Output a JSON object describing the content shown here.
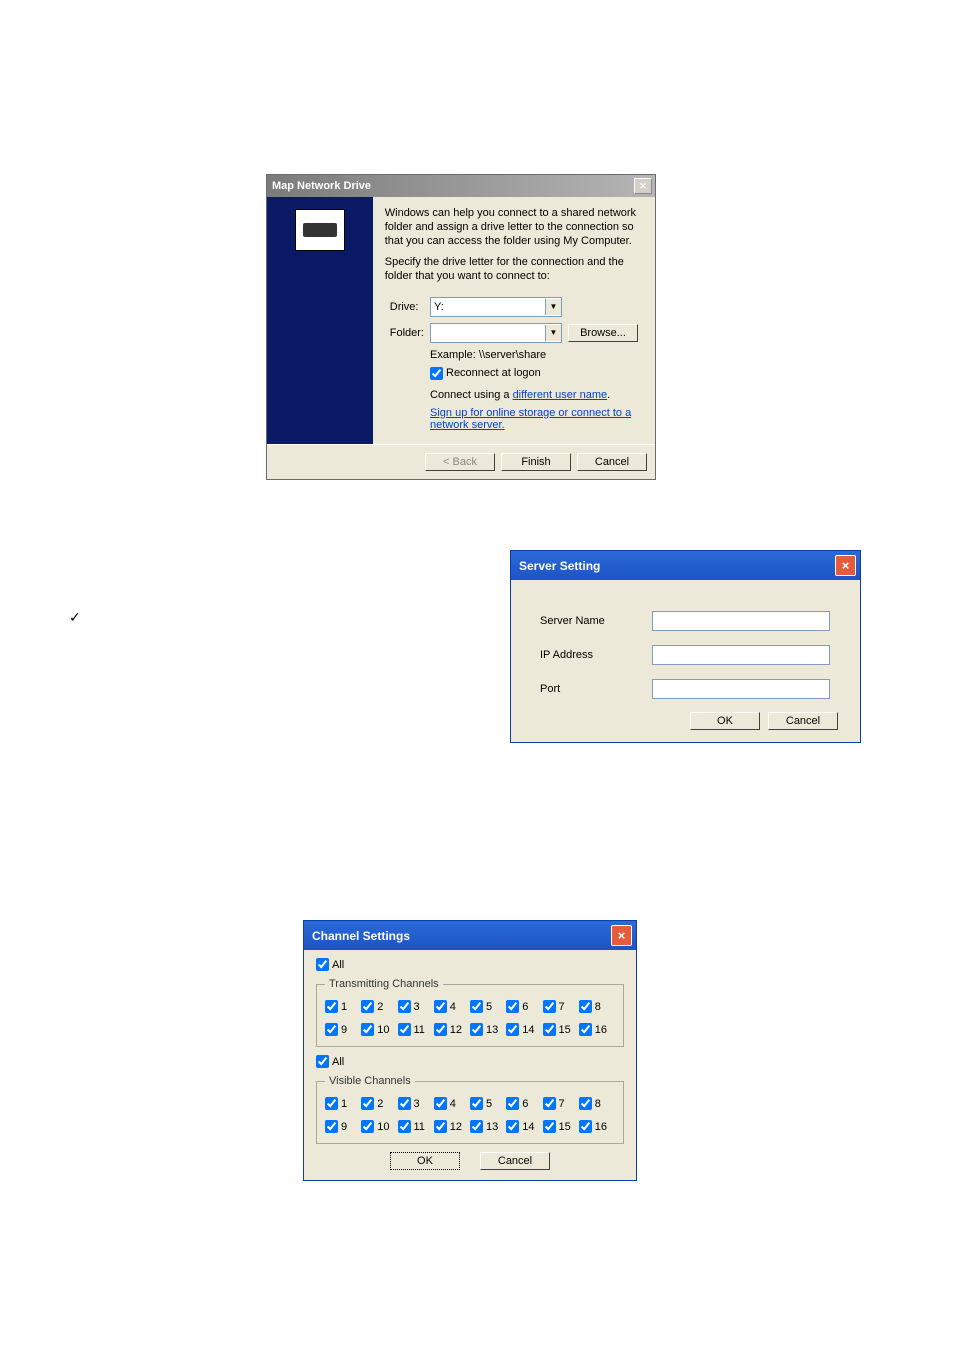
{
  "map_dialog": {
    "title": "Map Network Drive",
    "para1": "Windows can help you connect to a shared network folder and assign a drive letter to the connection so that you can access the folder using My Computer.",
    "para2": "Specify the drive letter for the connection and the folder that you want to connect to:",
    "drive_label": "Drive:",
    "drive_value": "Y:",
    "folder_label": "Folder:",
    "folder_value": "",
    "browse": "Browse...",
    "example": "Example: \\\\server\\share",
    "reconnect": "Reconnect at logon",
    "connect_prefix": "Connect using a ",
    "connect_link": "different user name",
    "connect_suffix": ".",
    "signup_link": "Sign up for online storage or connect to a network server.",
    "back": "< Back",
    "finish": "Finish",
    "cancel": "Cancel"
  },
  "server_dialog": {
    "title": "Server Setting",
    "name_label": "Server Name",
    "ip_label": "IP Address",
    "port_label": "Port",
    "ok": "OK",
    "cancel": "Cancel"
  },
  "channel_dialog": {
    "title": "Channel Settings",
    "all": "All",
    "tx_legend": "Transmitting Channels",
    "vis_legend": "Visible Channels",
    "channels": [
      "1",
      "2",
      "3",
      "4",
      "5",
      "6",
      "7",
      "8",
      "9",
      "10",
      "11",
      "12",
      "13",
      "14",
      "15",
      "16"
    ],
    "ok": "OK",
    "cancel": "Cancel"
  },
  "bullet": "✓"
}
